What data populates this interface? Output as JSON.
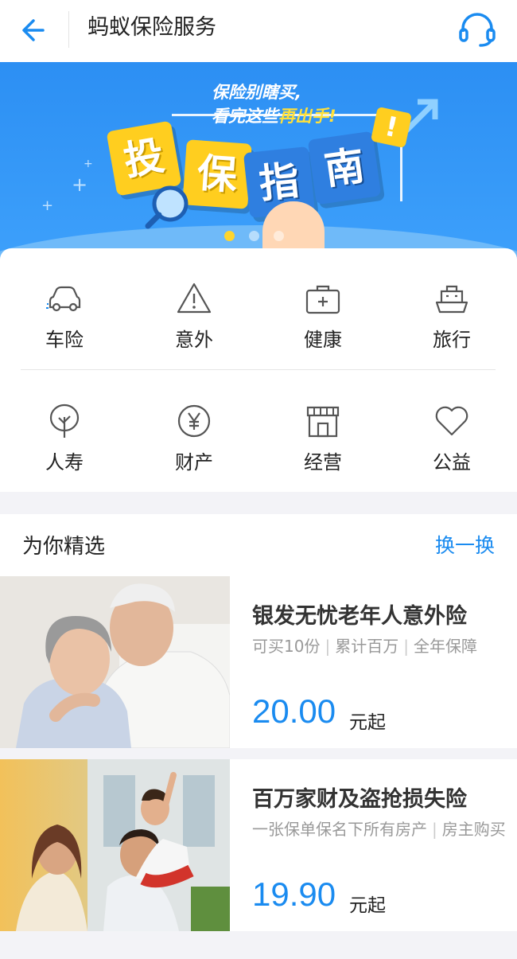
{
  "header": {
    "title": "蚂蚁保险服务",
    "back_icon": "arrow-left-icon",
    "service_icon": "headset-icon",
    "accent": "#1a8bf0"
  },
  "banner": {
    "line1": "保险别瞎买,",
    "line2_prefix": "看完这些",
    "line2_highlight": "再出手!",
    "tiles": [
      "投",
      "保",
      "指",
      "南"
    ],
    "exclaim": "!",
    "active_slide": 1,
    "slide_count": 3,
    "background": "#2c8ff3"
  },
  "categories": [
    {
      "label": "车险",
      "icon": "car-icon"
    },
    {
      "label": "意外",
      "icon": "warning-icon"
    },
    {
      "label": "健康",
      "icon": "medical-kit-icon"
    },
    {
      "label": "旅行",
      "icon": "ship-icon"
    },
    {
      "label": "人寿",
      "icon": "tree-icon"
    },
    {
      "label": "财产",
      "icon": "yen-icon"
    },
    {
      "label": "经营",
      "icon": "store-icon"
    },
    {
      "label": "公益",
      "icon": "heart-icon"
    }
  ],
  "picks": {
    "title": "为你精选",
    "swap_label": "换一换"
  },
  "products": [
    {
      "name": "银发无忧老年人意外险",
      "tags": [
        "可买10份",
        "累计百万",
        "全年保障"
      ],
      "price": "20.00",
      "unit": "元起"
    },
    {
      "name": "百万家财及盗抢损失险",
      "tags_text_1": "一张保单保名下所有房产",
      "tags_text_2": "房主购买",
      "price": "19.90",
      "unit": "元起"
    }
  ]
}
